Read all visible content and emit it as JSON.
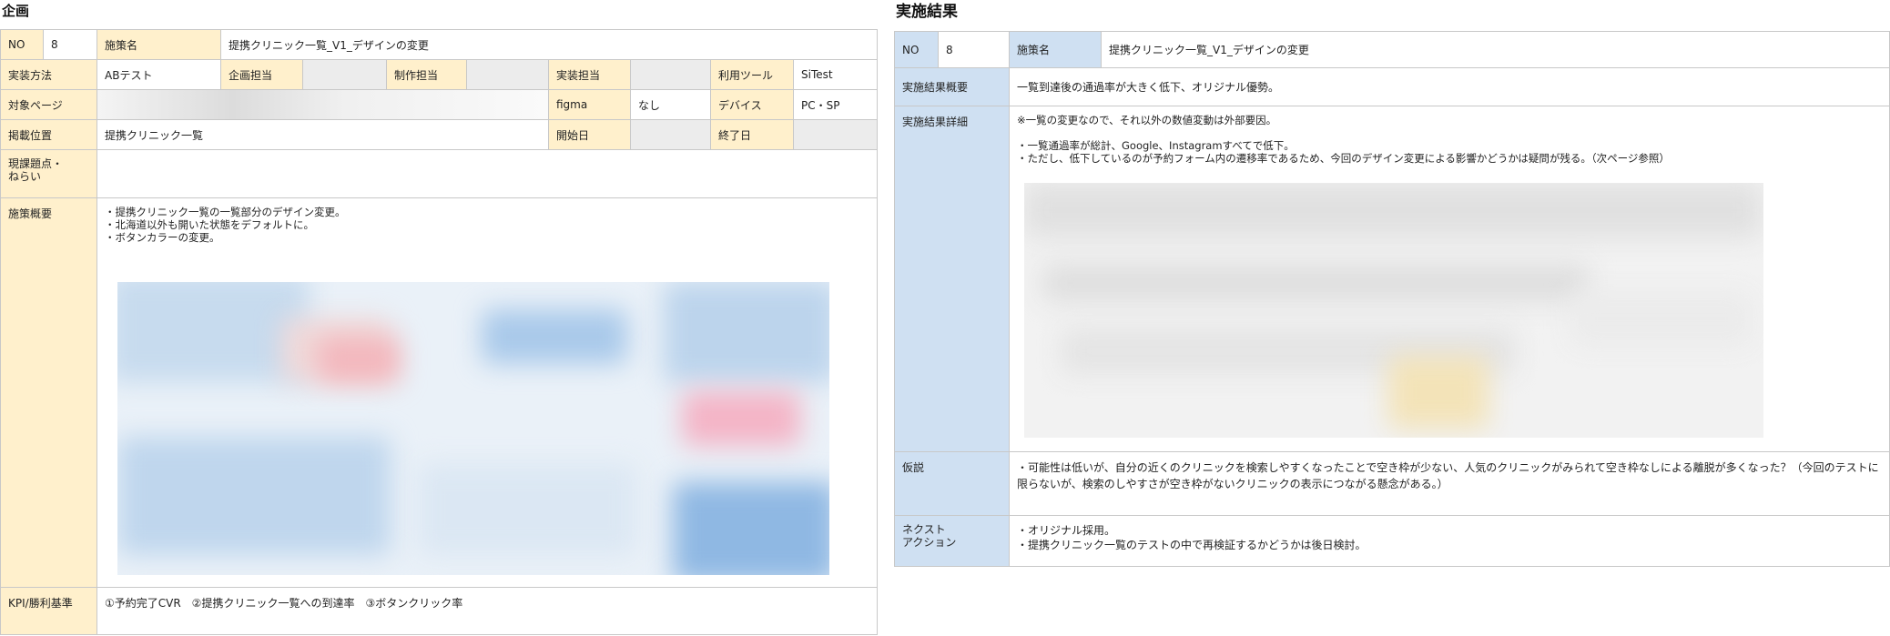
{
  "plan": {
    "title": "企画",
    "labels": {
      "no": "NO",
      "measure_name": "施策名",
      "method": "実装方法",
      "planner": "企画担当",
      "producer": "制作担当",
      "implementer": "実装担当",
      "tool": "利用ツール",
      "target_page": "対象ページ",
      "figma": "figma",
      "device": "デバイス",
      "position": "掲載位置",
      "start_date": "開始日",
      "end_date": "終了日",
      "issues": "現課題点・\nねらい",
      "summary": "施策概要",
      "kpi": "KPI/勝利基準"
    },
    "values": {
      "no": "8",
      "measure_name": "提携クリニック一覧_V1_デザインの変更",
      "method": "ABテスト",
      "tool": "SiTest",
      "figma": "なし",
      "device": "PC・SP",
      "position": "提携クリニック一覧",
      "summary": "・提携クリニック一覧の一覧部分のデザイン変更。\n・北海道以外も開いた状態をデフォルトに。\n・ボタンカラーの変更。",
      "kpi": "①予約完了CVR　②提携クリニック一覧への到達率　③ボタンクリック率"
    }
  },
  "result": {
    "title": "実施結果",
    "labels": {
      "no": "NO",
      "measure_name": "施策名",
      "overview": "実施結果概要",
      "detail": "実施結果詳細",
      "hypothesis": "仮説",
      "next": "ネクスト\nアクション"
    },
    "values": {
      "no": "8",
      "measure_name": "提携クリニック一覧_V1_デザインの変更",
      "overview": "一覧到達後の通過率が大きく低下、オリジナル優勢。",
      "detail": "※一覧の変更なので、それ以外の数値変動は外部要因。\n\n・一覧通過率が総計、Google、Instagramすべてで低下。\n・ただし、低下しているのが予約フォーム内の遷移率であるため、今回のデザイン変更による影響かどうかは疑問が残る。（次ページ参照）",
      "hypothesis": "・可能性は低いが、自分の近くのクリニックを検索しやすくなったことで空き枠が少ない、人気のクリニックがみられて空き枠なしによる離脱が多くなった？（今回のテストに限らないが、検索のしやすさが空き枠がないクリニックの表示につながる懸念がある。）",
      "next": "・オリジナル採用。\n・提携クリニック一覧のテストの中で再検証するかどうかは後日検討。"
    }
  }
}
